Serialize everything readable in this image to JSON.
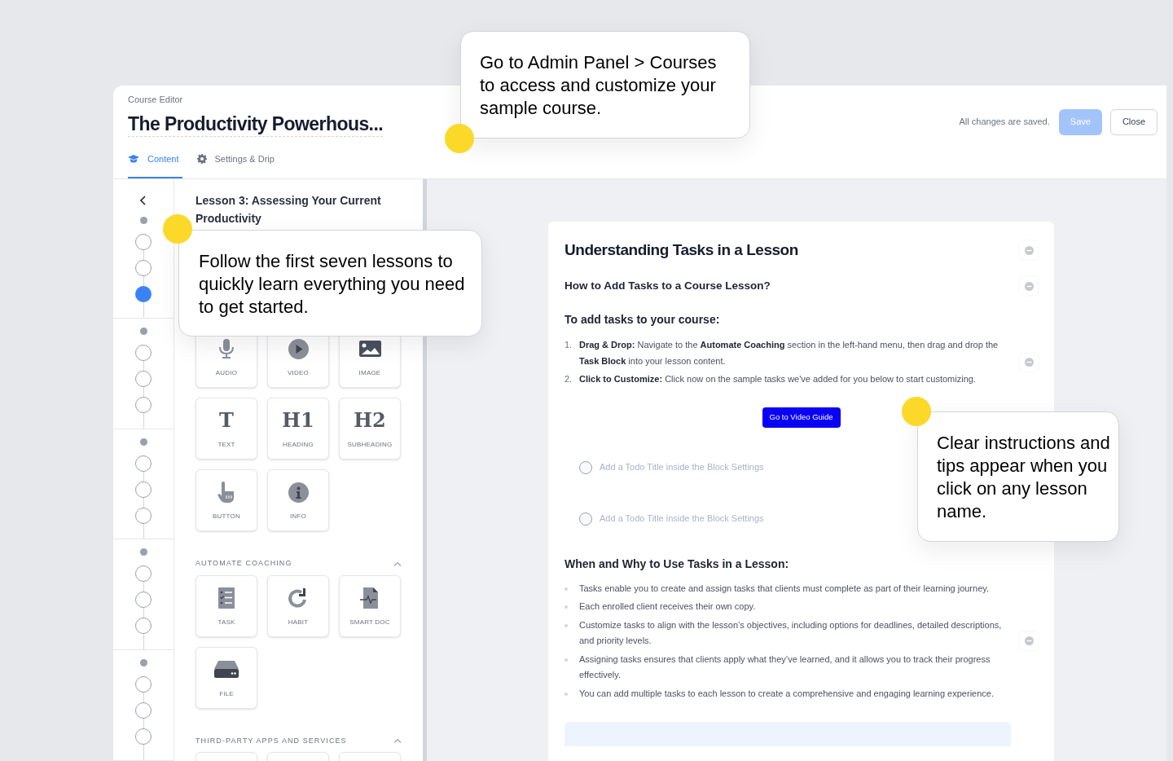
{
  "header": {
    "breadcrumb": "Course Editor",
    "title": "The Productivity Powerhous...",
    "tabs": [
      {
        "label": "Content",
        "selected": true
      },
      {
        "label": "Settings & Drip",
        "selected": false
      }
    ],
    "save_status": "All changes are saved.",
    "buttons": [
      {
        "label": "Save",
        "kind": "primary",
        "disabled": true
      },
      {
        "label": "Close",
        "kind": "secondary",
        "disabled": false
      }
    ]
  },
  "rail": {
    "sections": [
      {
        "lessons": [
          {
            "selected": false
          },
          {
            "selected": false
          },
          {
            "selected": true
          }
        ]
      },
      {
        "lessons": [
          {
            "selected": false
          },
          {
            "selected": false
          },
          {
            "selected": false
          }
        ]
      },
      {
        "lessons": [
          {
            "selected": false
          },
          {
            "selected": false
          },
          {
            "selected": false
          }
        ]
      },
      {
        "lessons": [
          {
            "selected": false
          },
          {
            "selected": false
          },
          {
            "selected": false
          }
        ]
      },
      {
        "lessons": [
          {
            "selected": false
          },
          {
            "selected": false
          },
          {
            "selected": false
          }
        ]
      }
    ]
  },
  "palette": {
    "lesson_title": "Lesson 3: Assessing Your Current Productivity",
    "groups": [
      {
        "blocks": [
          {
            "kind": "audio",
            "label": "AUDIO"
          },
          {
            "kind": "video",
            "label": "VIDEO"
          },
          {
            "kind": "image",
            "label": "IMAGE"
          },
          {
            "kind": "glyph",
            "glyph": "T",
            "label": "TEXT"
          },
          {
            "kind": "glyph",
            "glyph": "H1",
            "label": "HEADING"
          },
          {
            "kind": "glyph",
            "glyph": "H2",
            "label": "SUBHEADING"
          },
          {
            "kind": "button",
            "label": "BUTTON"
          },
          {
            "kind": "info",
            "label": "INFO"
          }
        ]
      },
      {
        "heading": "AUTOMATE COACHING",
        "expanded": true,
        "blocks": [
          {
            "kind": "task",
            "label": "TASK"
          },
          {
            "kind": "habit",
            "label": "HABIT"
          },
          {
            "kind": "smartdoc",
            "label": "SMART DOC"
          },
          {
            "kind": "file",
            "label": "FILE"
          }
        ]
      },
      {
        "heading": "THIRD-PARTY APPS AND SERVICES",
        "expanded": true,
        "blocks": [
          {
            "kind": "cut"
          },
          {
            "kind": "cut"
          },
          {
            "kind": "cut"
          }
        ]
      }
    ]
  },
  "lesson": {
    "blocks": [
      {
        "kind": "title",
        "text": "Understanding Tasks in a Lesson",
        "collapse_icon": true
      },
      {
        "kind": "subtitle",
        "text": "How to Add Tasks to a Course Lesson?",
        "collapse_icon": true
      },
      {
        "kind": "heading",
        "text": "To add tasks to your course:"
      },
      {
        "kind": "ordered",
        "collapse_icon": true,
        "items": [
          {
            "marker": "1.",
            "text": "**Drag & Drop:** Navigate to the **Automate Coaching** section in the left-hand menu, then drag and drop the **Task Block** into your lesson content."
          },
          {
            "marker": "2.",
            "text": "**Click to Customize:** Click now on the sample tasks we've added for you below to start customizing."
          }
        ]
      },
      {
        "kind": "button",
        "text": "Go to Video Guide"
      },
      {
        "kind": "todo",
        "text": "Add a Todo Title inside the Block Settings",
        "checked": false
      },
      {
        "kind": "todo",
        "text": "Add a Todo Title inside the Block Settings",
        "checked": false
      },
      {
        "kind": "heading",
        "text": "When and Why to Use Tasks in a Lesson:"
      },
      {
        "kind": "bullets",
        "collapse_icon": true,
        "items": [
          "Tasks enable you to create and assign tasks that clients must complete as part of their learning journey.",
          "Each enrolled client receives their own copy.",
          "Customize tasks to align with the lesson’s objectives, including options for deadlines, detailed descriptions, and priority levels.",
          "Assigning tasks ensures that clients apply what they’ve learned, and it allows you to track their progress effectively.",
          "You can add multiple tasks to each lesson to create a comprehensive and engaging learning experience."
        ]
      },
      {
        "kind": "note"
      }
    ]
  },
  "callouts": [
    {
      "text": "Go to Admin Panel > Courses to access and customize your sample course."
    },
    {
      "text": "Follow the first seven lessons to quickly learn everything you need to get started."
    },
    {
      "text": "Clear instructions and tips appear when you click on any lesson name."
    }
  ]
}
